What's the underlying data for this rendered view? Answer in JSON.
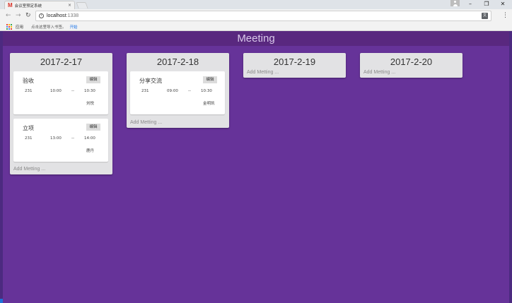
{
  "browser": {
    "tab_title": "会议室预定系统",
    "tab_favicon": "M",
    "url_host": "localhost",
    "url_port": ":1338",
    "bookmarks_apps": "应用",
    "bookmarks_hint": "点击这里导入书签。",
    "bookmarks_link": "开始",
    "icons": [
      "back-arrow-icon",
      "forward-arrow-icon",
      "reload-icon",
      "info-icon",
      "translate-icon",
      "menu-icon",
      "profile-icon"
    ],
    "apps_icon_colors": [
      "#ea4335",
      "#fbbc05",
      "#34a853",
      "#4285f4",
      "#ea4335",
      "#fbbc05",
      "#34a853",
      "#4285f4",
      "#ea4335"
    ]
  },
  "app": {
    "title": "Meeting",
    "colors": {
      "background": "#663399",
      "header": "#59287f",
      "card_column": "#e2e2e4"
    },
    "add_label": "Add Metting ...",
    "edit_label": "编辑",
    "separator": "--",
    "days": [
      {
        "date": "2017-2-17",
        "meetings": [
          {
            "title": "验收",
            "room": "231",
            "start": "10:00",
            "end": "10:30",
            "person": "刘悦"
          },
          {
            "title": "立项",
            "room": "231",
            "start": "13:00",
            "end": "14:00",
            "person": "鹿丹"
          }
        ]
      },
      {
        "date": "2017-2-18",
        "meetings": [
          {
            "title": "分享交流",
            "room": "231",
            "start": "09:00",
            "end": "10:30",
            "person": "金明凯"
          }
        ]
      },
      {
        "date": "2017-2-19",
        "meetings": []
      },
      {
        "date": "2017-2-20",
        "meetings": []
      }
    ]
  }
}
